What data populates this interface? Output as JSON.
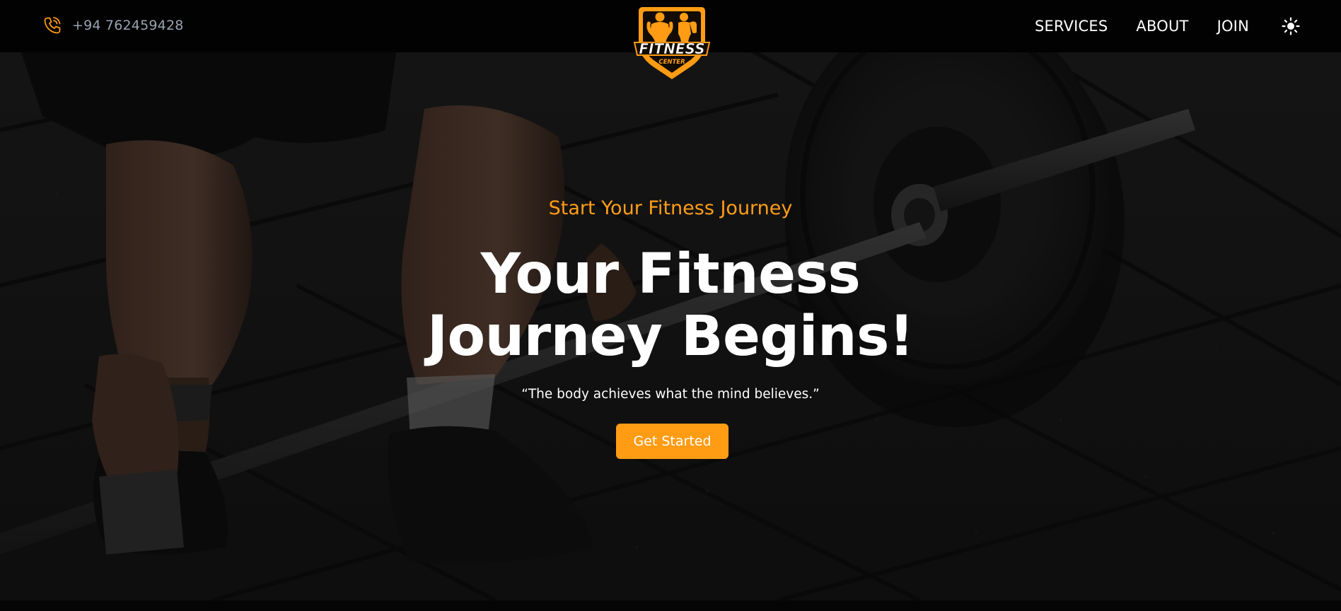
{
  "header": {
    "phone_number": "+94 762459428",
    "phone_icon": "phone-icon",
    "logo": {
      "title": "FITNESS",
      "subtitle": "CENTER"
    },
    "nav": [
      {
        "label": "SERVICES"
      },
      {
        "label": "ABOUT"
      },
      {
        "label": "JOIN"
      }
    ],
    "theme_icon": "sun-icon"
  },
  "hero": {
    "eyebrow": "Start Your Fitness Journey",
    "title_line1": "Your Fitness",
    "title_line2": "Journey Begins!",
    "quote": "“The body achieves what the mind believes.”",
    "cta_label": "Get Started"
  },
  "colors": {
    "accent": "#ff9c14",
    "header_bg": "#020202",
    "nav_text": "#ffffff",
    "phone_text": "#9aa4b2"
  }
}
